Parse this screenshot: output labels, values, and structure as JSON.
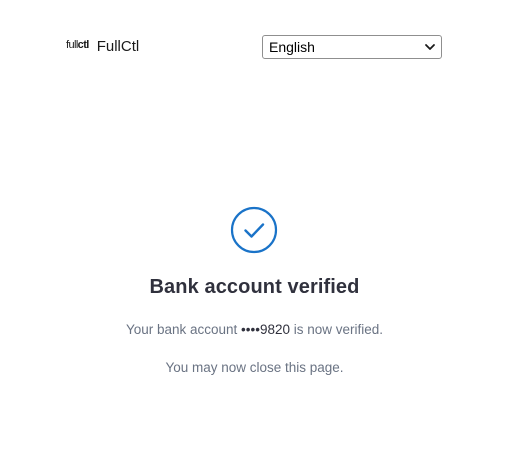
{
  "header": {
    "logo_text_a": "full",
    "logo_text_b": "ctl",
    "brand_name": "FullCtl",
    "language_selected": "English"
  },
  "status": {
    "icon": "checkmark-circle-icon",
    "accent_color": "#1a73c8"
  },
  "content": {
    "title": "Bank account verified",
    "message_prefix": "Your bank account ",
    "account_mask": "••••9820",
    "message_suffix": " is now verified.",
    "close_note": "You may now close this page."
  }
}
